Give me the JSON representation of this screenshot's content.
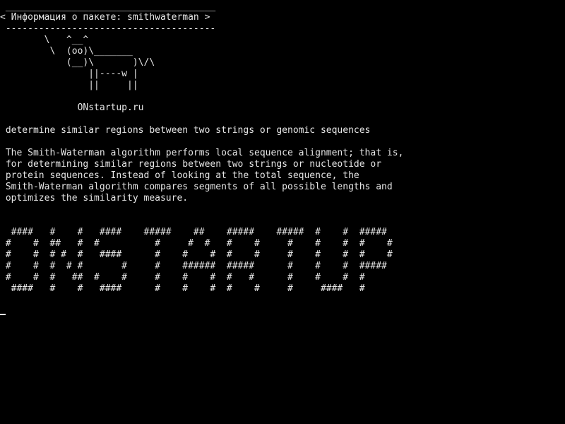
{
  "terminal": {
    "colors": {
      "background": "#000000",
      "foreground": "#e6e6e6"
    },
    "lines": [
      " ______________________________________",
      "< Информация о пакете: smithwaterman >",
      " --------------------------------------",
      "        \\   ^__^",
      "         \\  (oo)\\_______",
      "            (__)\\       )\\/\\",
      "                ||----w |",
      "                ||     ||",
      "",
      "              ONstartup.ru",
      "",
      " determine similar regions between two strings or genomic sequences",
      "",
      " The Smith-Waterman algorithm performs local sequence alignment; that is,",
      " for determining similar regions between two strings or nucleotide or",
      " protein sequences. Instead of looking at the total sequence, the",
      " Smith-Waterman algorithm compares segments of all possible lengths and",
      " optimizes the similarity measure.",
      "",
      "",
      "  ####   #    #   ####    #####    ##    #####    #####  #    #  #####",
      " #    #  ##   #  #          #     #  #   #    #     #    #    #  #    #",
      " #    #  # #  #   ####      #    #    #  #    #     #    #    #  #    #",
      " #    #  #  # #       #     #    ######  #####      #    #    #  #####",
      " #    #  #   ##  #    #     #    #    #  #   #      #    #    #  #",
      "  ####   #    #   ####      #    #    #  #    #     #     ####   #"
    ]
  }
}
